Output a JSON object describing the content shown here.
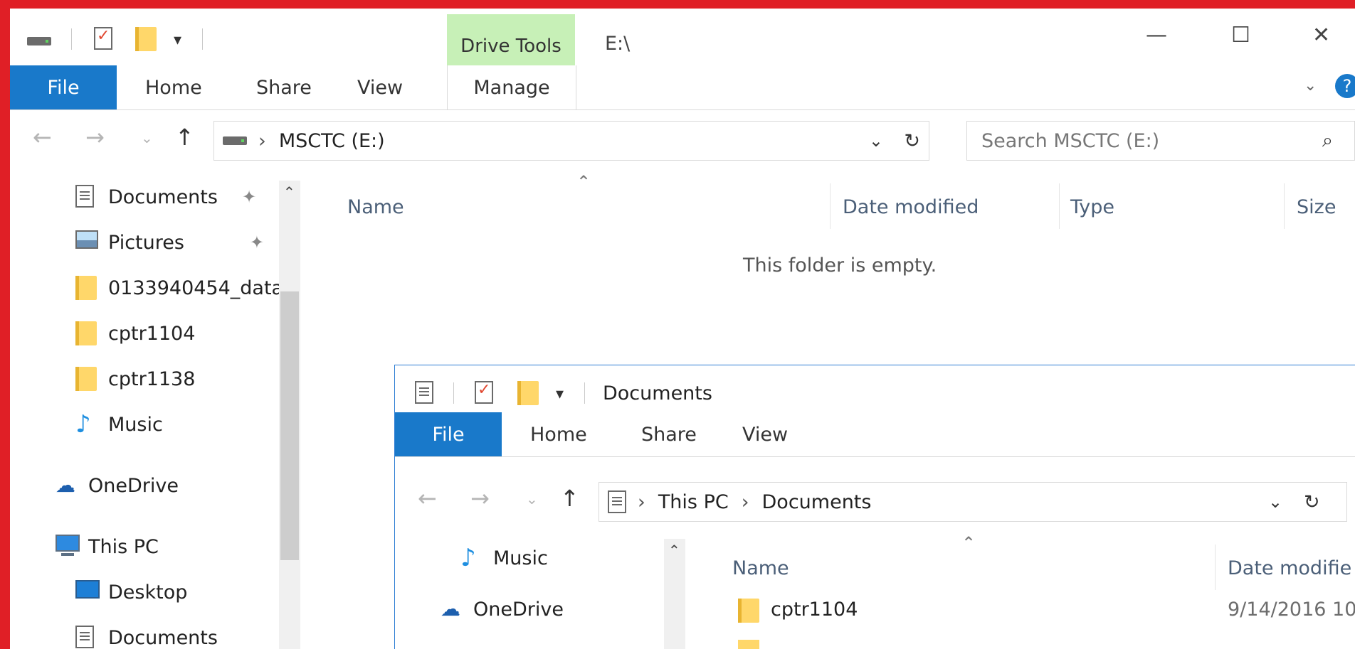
{
  "back_window": {
    "title": "E:\\",
    "contextual_tab_group": "Drive Tools",
    "ribbon_tabs": {
      "file": "File",
      "home": "Home",
      "share": "Share",
      "view": "View",
      "manage": "Manage"
    },
    "window_controls": {
      "minimize": "—",
      "maximize": "☐",
      "close": "✕"
    },
    "address": {
      "path": "MSCTC (E:)"
    },
    "search": {
      "placeholder": "Search MSCTC (E:)"
    },
    "nav_pane": [
      {
        "label": "Documents",
        "icon": "document-icon",
        "pinned": true
      },
      {
        "label": "Pictures",
        "icon": "pictures-icon",
        "pinned": true
      },
      {
        "label": "0133940454_data",
        "icon": "folder-icon"
      },
      {
        "label": "cptr1104",
        "icon": "folder-icon"
      },
      {
        "label": "cptr1138",
        "icon": "folder-icon"
      },
      {
        "label": "Music",
        "icon": "music-icon"
      },
      {
        "label": "OneDrive",
        "icon": "onedrive-icon"
      },
      {
        "label": "This PC",
        "icon": "this-pc-icon"
      },
      {
        "label": "Desktop",
        "icon": "desktop-icon"
      },
      {
        "label": "Documents",
        "icon": "document-icon"
      }
    ],
    "columns": {
      "name": "Name",
      "date_modified": "Date modified",
      "type": "Type",
      "size": "Size"
    },
    "empty_message": "This folder is empty."
  },
  "front_window": {
    "title": "Documents",
    "ribbon_tabs": {
      "file": "File",
      "home": "Home",
      "share": "Share",
      "view": "View"
    },
    "address": {
      "root": "This PC",
      "folder": "Documents"
    },
    "nav_pane": [
      {
        "label": "Music",
        "icon": "music-icon"
      },
      {
        "label": "OneDrive",
        "icon": "onedrive-icon"
      }
    ],
    "columns": {
      "name": "Name",
      "date_modified": "Date modifie"
    },
    "rows": [
      {
        "name": "cptr1104",
        "date": "9/14/2016 10"
      }
    ]
  },
  "colors": {
    "accent": "#1979ca",
    "drive_tools": "#c7f0b7",
    "background": "#e01f26"
  }
}
